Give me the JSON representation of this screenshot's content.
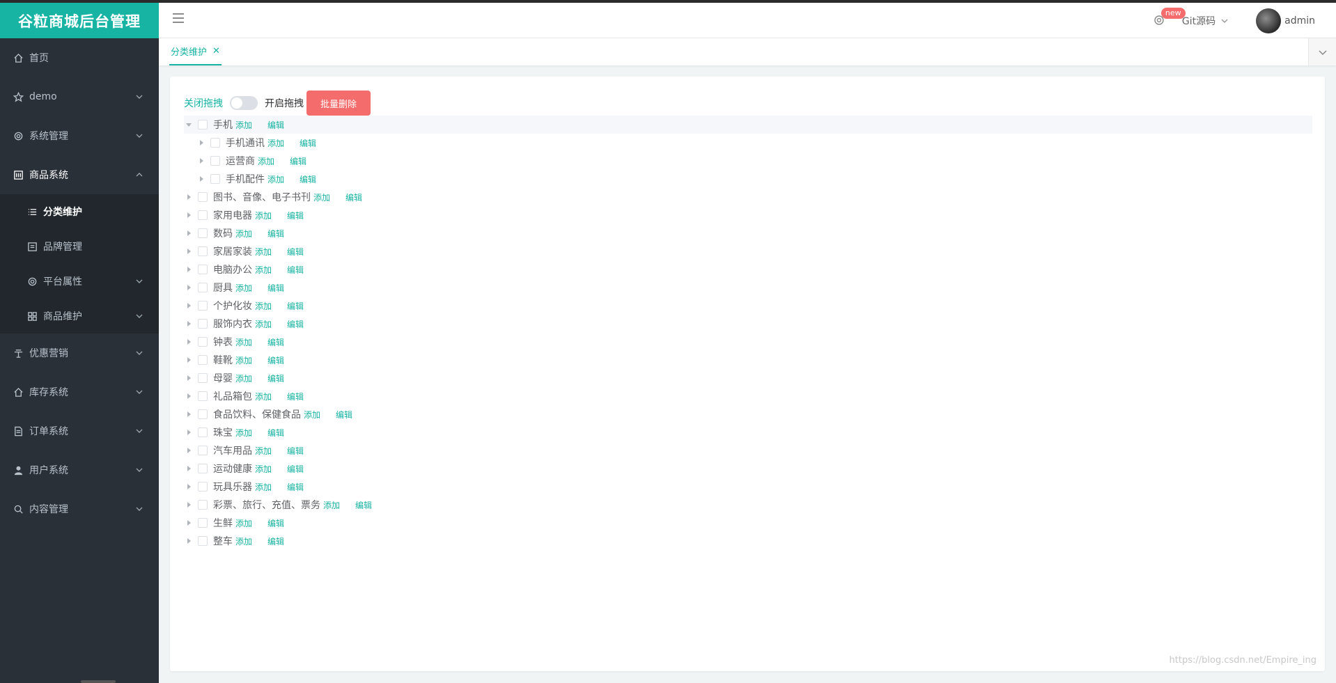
{
  "brand": "谷粒商城后台管理",
  "header": {
    "badge": "new",
    "git_label": "Git源码",
    "user": "admin"
  },
  "sidebar": {
    "items": [
      {
        "label": "首页",
        "icon": "home-icon"
      },
      {
        "label": "demo",
        "icon": "star-icon"
      },
      {
        "label": "系统管理",
        "icon": "gear-icon"
      },
      {
        "label": "商品系统",
        "icon": "product-icon"
      },
      {
        "label": "优惠营销",
        "icon": "umbrella-icon"
      },
      {
        "label": "库存系统",
        "icon": "home-icon"
      },
      {
        "label": "订单系统",
        "icon": "document-icon"
      },
      {
        "label": "用户系统",
        "icon": "user-icon"
      },
      {
        "label": "内容管理",
        "icon": "search-icon"
      }
    ],
    "sub": [
      {
        "label": "分类维护",
        "icon": "list-icon"
      },
      {
        "label": "品牌管理",
        "icon": "brand-icon"
      },
      {
        "label": "平台属性",
        "icon": "gear-icon"
      },
      {
        "label": "商品维护",
        "icon": "grid-icon"
      }
    ]
  },
  "tabs": [
    {
      "label": "分类维护"
    }
  ],
  "toolbar": {
    "switch_off_label": "关闭拖拽",
    "switch_on_label": "开启拖拽",
    "delete_label": "批量删除"
  },
  "tree": {
    "add_label": "添加",
    "edit_label": "编辑",
    "root": "手机",
    "children": [
      "手机通讯",
      "运营商",
      "手机配件"
    ],
    "nodes": [
      "图书、音像、电子书刊",
      "家用电器",
      "数码",
      "家居家装",
      "电脑办公",
      "厨具",
      "个护化妆",
      "服饰内衣",
      "钟表",
      "鞋靴",
      "母婴",
      "礼品箱包",
      "食品饮料、保健食品",
      "珠宝",
      "汽车用品",
      "运动健康",
      "玩具乐器",
      "彩票、旅行、充值、票务",
      "生鲜",
      "整车"
    ]
  },
  "watermark": "https://blog.csdn.net/Empire_ing"
}
